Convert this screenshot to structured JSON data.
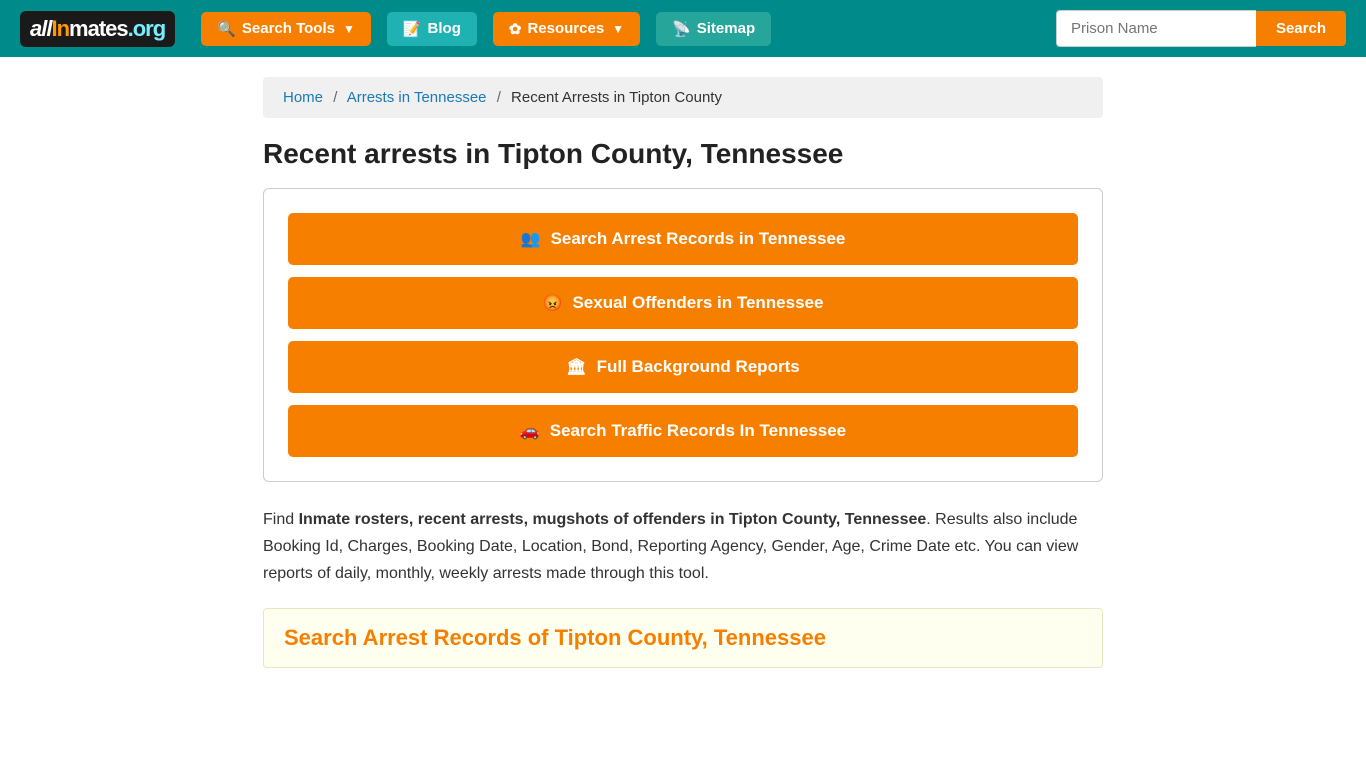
{
  "header": {
    "logo_text": "allInmates.org",
    "logo_all": "all",
    "logo_inmates": "Inmates",
    "logo_org": ".org",
    "nav": [
      {
        "id": "search-tools",
        "label": "Search Tools",
        "icon": "search-icon",
        "has_dropdown": true
      },
      {
        "id": "blog",
        "label": "Blog",
        "icon": "blog-icon",
        "has_dropdown": false
      },
      {
        "id": "resources",
        "label": "Resources",
        "icon": "resources-icon",
        "has_dropdown": true
      },
      {
        "id": "sitemap",
        "label": "Sitemap",
        "icon": "sitemap-icon",
        "has_dropdown": false
      }
    ],
    "search_placeholder": "Prison Name",
    "search_button_label": "Search"
  },
  "breadcrumb": {
    "items": [
      {
        "label": "Home",
        "href": "#"
      },
      {
        "label": "Arrests in Tennessee",
        "href": "#"
      },
      {
        "label": "Recent Arrests in Tipton County",
        "href": null
      }
    ]
  },
  "page": {
    "title": "Recent arrests in Tipton County, Tennessee",
    "action_buttons": [
      {
        "id": "arrest-records",
        "label": "Search Arrest Records in Tennessee",
        "icon": "people-icon"
      },
      {
        "id": "sexual-offenders",
        "label": "Sexual Offenders in Tennessee",
        "icon": "angry-icon"
      },
      {
        "id": "background-reports",
        "label": "Full Background Reports",
        "icon": "building-icon"
      },
      {
        "id": "traffic-records",
        "label": "Search Traffic Records In Tennessee",
        "icon": "car-icon"
      }
    ],
    "description_part1": "Find ",
    "description_bold": "Inmate rosters, recent arrests, mugshots of offenders in Tipton County, Tennessee",
    "description_part2": ". Results also include Booking Id, Charges, Booking Date, Location, Bond, Reporting Agency, Gender, Age, Crime Date etc. You can view reports of daily, monthly, weekly arrests made through this tool.",
    "section_title": "Search Arrest Records of Tipton County, Tennessee"
  }
}
